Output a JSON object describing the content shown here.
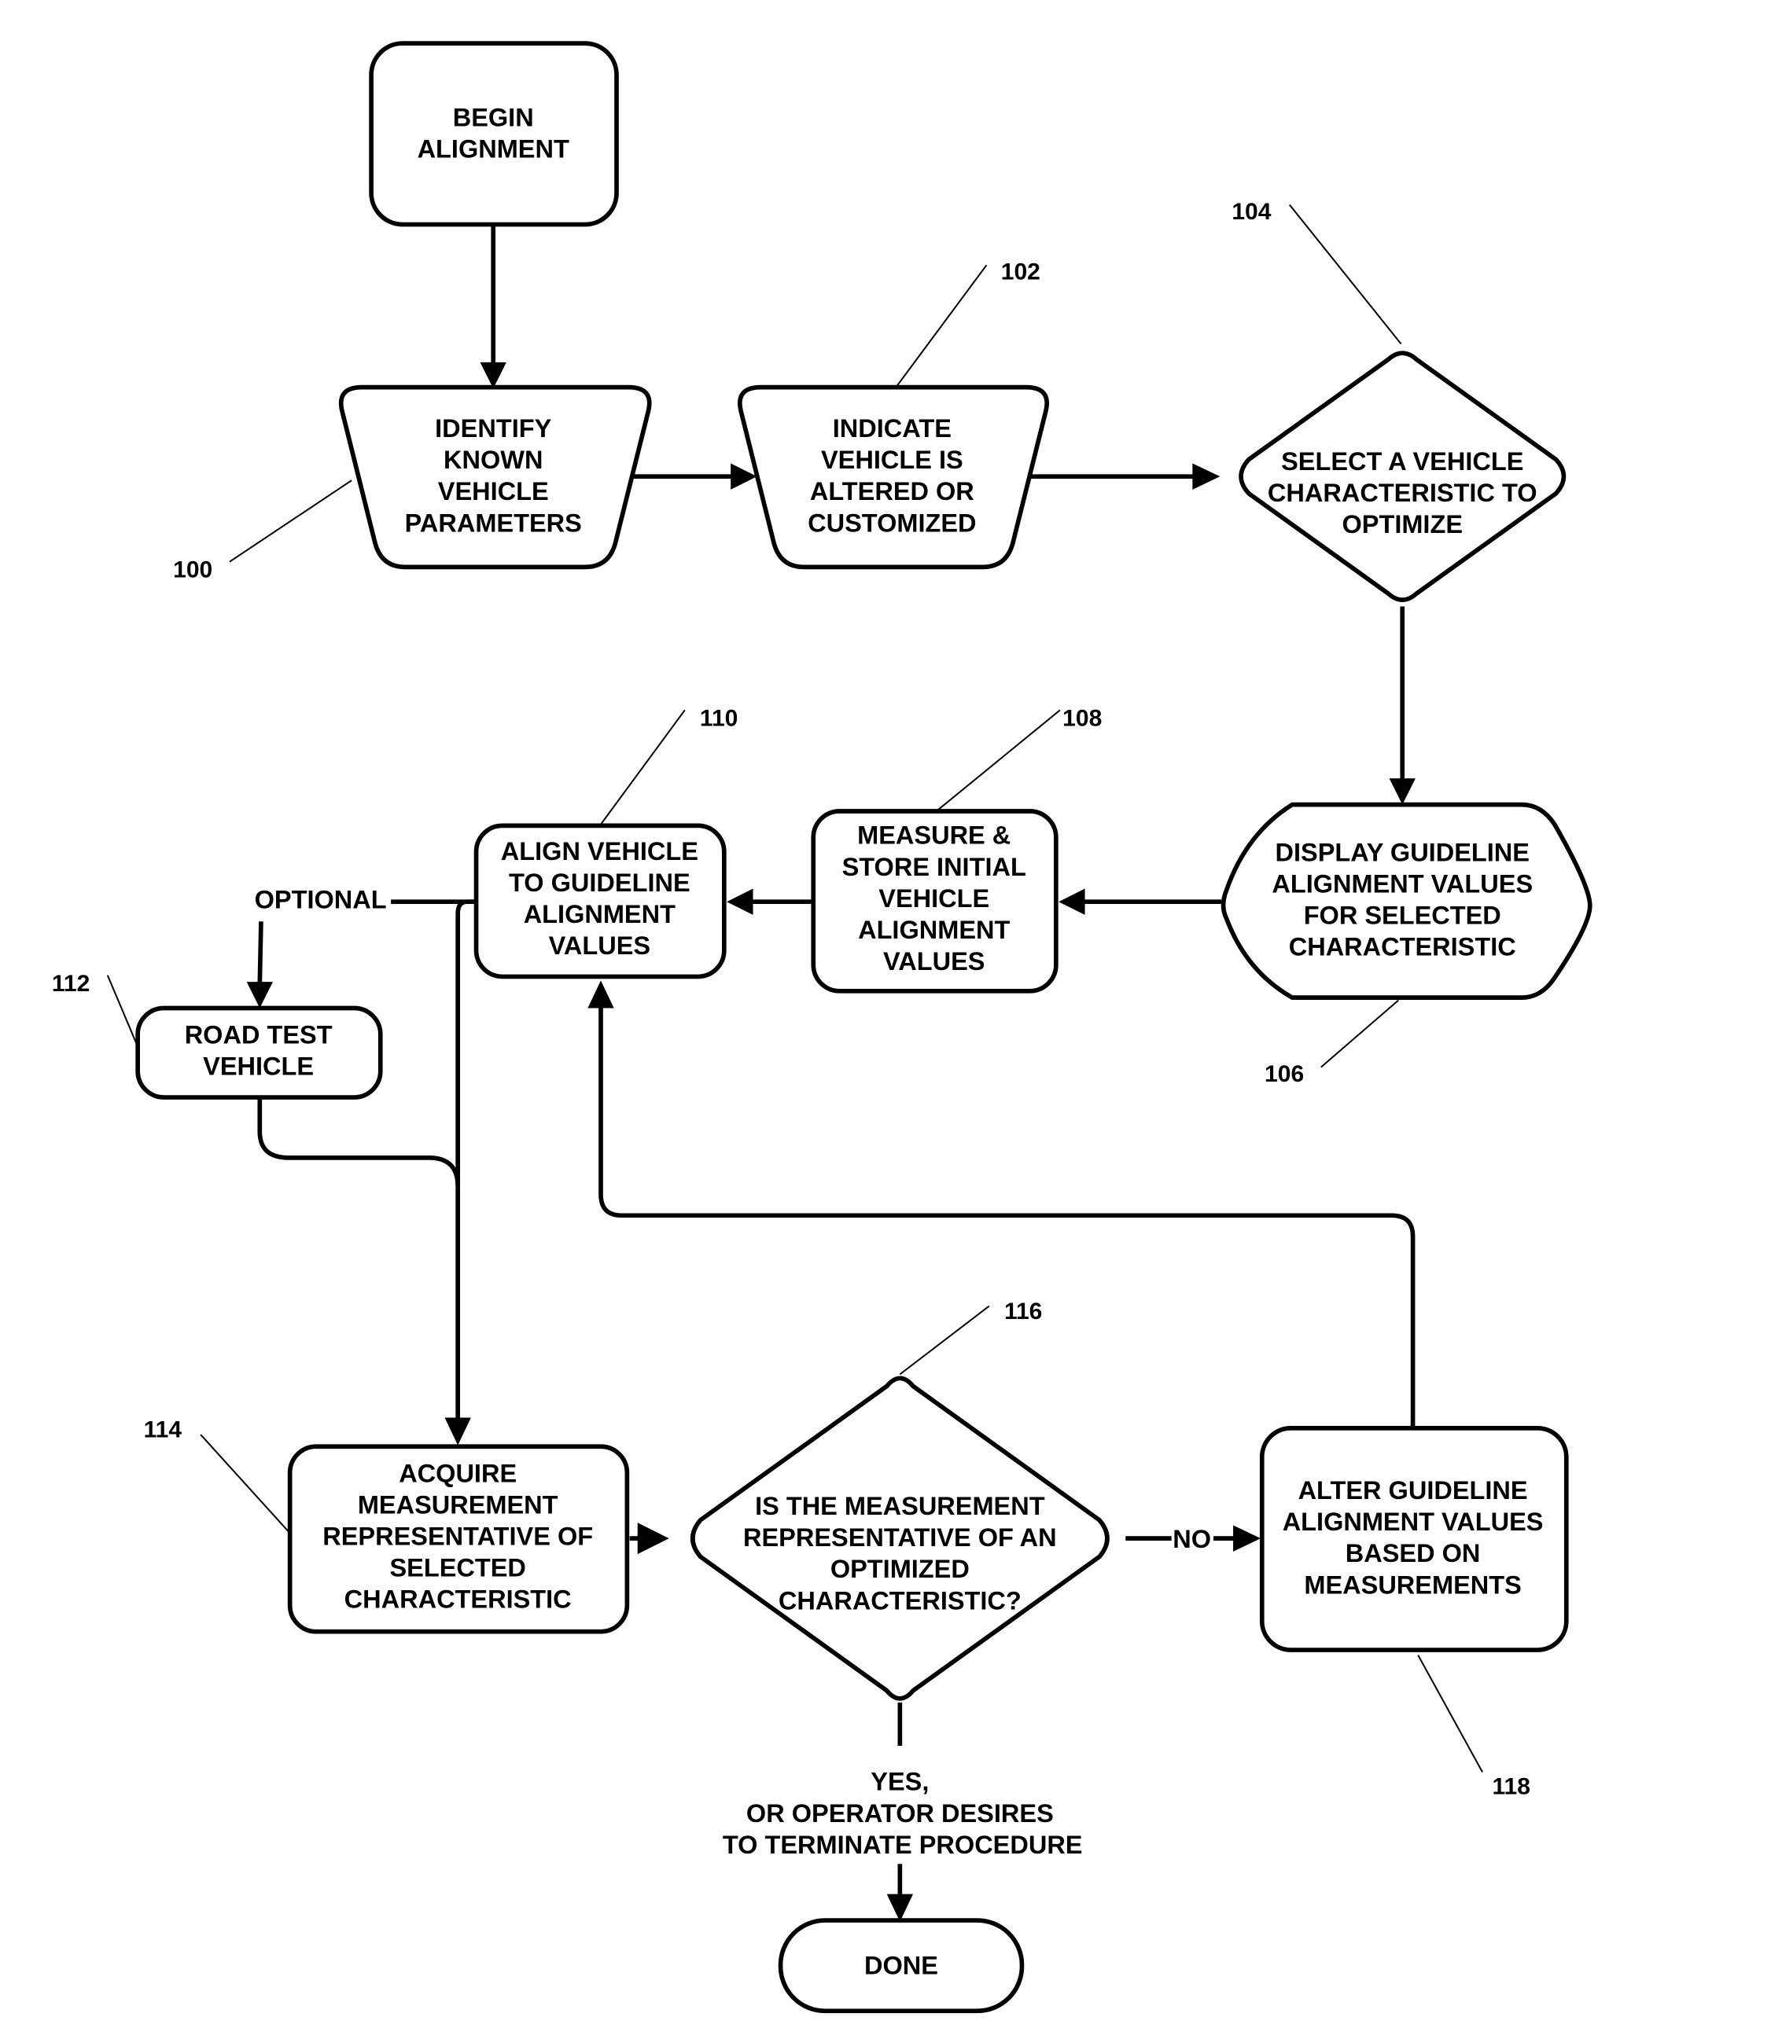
{
  "diagram": {
    "type": "flowchart",
    "nodes": {
      "begin": {
        "shape": "rounded-rect",
        "lines": [
          "BEGIN",
          "ALIGNMENT"
        ]
      },
      "n100": {
        "ref": "100",
        "shape": "trapezoid",
        "lines": [
          "IDENTIFY",
          "KNOWN",
          "VEHICLE",
          "PARAMETERS"
        ]
      },
      "n102": {
        "ref": "102",
        "shape": "trapezoid",
        "lines": [
          "INDICATE",
          "VEHICLE IS",
          "ALTERED OR",
          "CUSTOMIZED"
        ]
      },
      "n104": {
        "ref": "104",
        "shape": "diamond",
        "lines": [
          "SELECT A VEHICLE",
          "CHARACTERISTIC TO",
          "OPTIMIZE"
        ]
      },
      "n106": {
        "ref": "106",
        "shape": "display",
        "lines": [
          "DISPLAY GUIDELINE",
          "ALIGNMENT VALUES",
          "FOR SELECTED",
          "CHARACTERISTIC"
        ]
      },
      "n108": {
        "ref": "108",
        "shape": "rounded-rect",
        "lines": [
          "MEASURE &",
          "STORE INITIAL",
          "VEHICLE",
          "ALIGNMENT",
          "VALUES"
        ]
      },
      "n110": {
        "ref": "110",
        "shape": "rounded-rect",
        "lines": [
          "ALIGN VEHICLE",
          "TO GUIDELINE",
          "ALIGNMENT",
          "VALUES"
        ]
      },
      "n112": {
        "ref": "112",
        "shape": "rounded-rect",
        "lines": [
          "ROAD TEST",
          "VEHICLE"
        ]
      },
      "n114": {
        "ref": "114",
        "shape": "rounded-rect",
        "lines": [
          "ACQUIRE",
          "MEASUREMENT",
          "REPRESENTATIVE OF",
          "SELECTED",
          "CHARACTERISTIC"
        ]
      },
      "n116": {
        "ref": "116",
        "shape": "diamond",
        "lines": [
          "IS THE MEASUREMENT",
          "REPRESENTATIVE OF AN",
          "OPTIMIZED",
          "CHARACTERISTIC?"
        ]
      },
      "n118": {
        "ref": "118",
        "shape": "rounded-rect",
        "lines": [
          "ALTER GUIDELINE",
          "ALIGNMENT VALUES",
          "BASED ON",
          "MEASUREMENTS"
        ]
      },
      "done": {
        "shape": "terminal",
        "lines": [
          "DONE"
        ]
      }
    },
    "edge_labels": {
      "optional": "OPTIONAL",
      "no": "NO",
      "yes_lines": [
        "YES,",
        "OR OPERATOR DESIRES",
        "TO TERMINATE PROCEDURE"
      ]
    },
    "edges": [
      {
        "from": "begin",
        "to": "n100"
      },
      {
        "from": "n100",
        "to": "n102"
      },
      {
        "from": "n102",
        "to": "n104"
      },
      {
        "from": "n104",
        "to": "n106"
      },
      {
        "from": "n106",
        "to": "n108"
      },
      {
        "from": "n108",
        "to": "n110"
      },
      {
        "from": "n110",
        "to": "n112",
        "label": "OPTIONAL"
      },
      {
        "from": "n110",
        "to": "n114"
      },
      {
        "from": "n112",
        "to": "n114"
      },
      {
        "from": "n114",
        "to": "n116"
      },
      {
        "from": "n116",
        "to": "n118",
        "label": "NO"
      },
      {
        "from": "n118",
        "to": "n110"
      },
      {
        "from": "n116",
        "to": "done",
        "label": "YES, OR OPERATOR DESIRES TO TERMINATE PROCEDURE"
      }
    ]
  }
}
